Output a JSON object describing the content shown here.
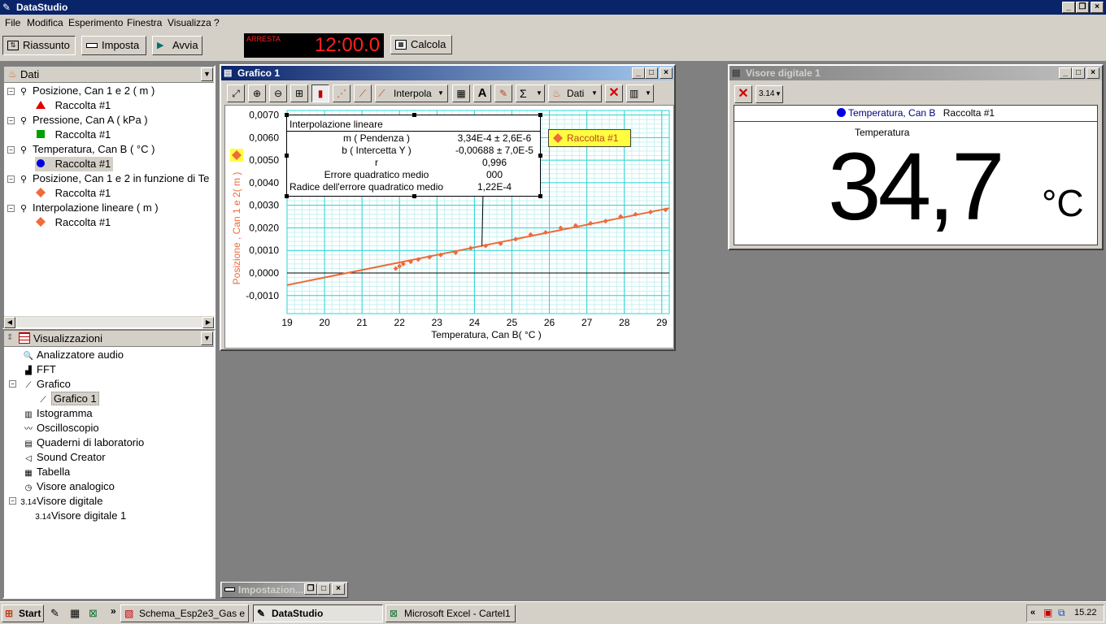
{
  "app": {
    "title": "DataStudio"
  },
  "menu": [
    "File",
    "Modifica",
    "Esperimento",
    "Finestra",
    "Visualizza",
    "?"
  ],
  "toolbar": {
    "summary": "Riassunto",
    "setup": "Imposta",
    "start": "Avvia",
    "timer_status": "ARRESTA",
    "timer": "12:00.0",
    "calc": "Calcola"
  },
  "data_panel": {
    "header": "Dati",
    "items": [
      {
        "label": "Posizione, Can 1 e 2 ( m )",
        "sub": "Raccolta #1",
        "color": "#e00000",
        "marker": "triangle"
      },
      {
        "label": "Pressione, Can A ( kPa )",
        "sub": "Raccolta #1",
        "color": "#00a000",
        "marker": "square"
      },
      {
        "label": "Temperatura, Can B ( °C )",
        "sub": "Raccolta #1",
        "color": "#0000e0",
        "marker": "circle"
      },
      {
        "label": "Posizione, Can 1 e 2 in funzione di Te",
        "sub": "Raccolta #1",
        "color": "#f06a3a",
        "marker": "diamond"
      },
      {
        "label": "Interpolazione lineare ( m )",
        "sub": "Raccolta #1",
        "color": "#f06a3a",
        "marker": "diamond"
      }
    ]
  },
  "views_panel": {
    "header": "Visualizzazioni",
    "items": [
      {
        "label": "Analizzatore audio",
        "level": 1
      },
      {
        "label": "FFT",
        "level": 1
      },
      {
        "label": "Grafico",
        "level": 1
      },
      {
        "label": "Grafico 1",
        "level": 2
      },
      {
        "label": "Istogramma",
        "level": 1
      },
      {
        "label": "Oscilloscopio",
        "level": 1
      },
      {
        "label": "Quaderni di laboratorio",
        "level": 1
      },
      {
        "label": "Sound Creator",
        "level": 1
      },
      {
        "label": "Tabella",
        "level": 1
      },
      {
        "label": "Visore analogico",
        "level": 1
      },
      {
        "label": "Visore digitale",
        "level": 1
      },
      {
        "label": "Visore digitale 1",
        "level": 2
      }
    ]
  },
  "graph_window": {
    "title": "Grafico 1",
    "toolbar": {
      "fit": "Interpola",
      "data": "Dati"
    },
    "legend": "Raccolta #1",
    "stats_box": {
      "title": "Interpolazione lineare",
      "rows": [
        {
          "label": "m ( Pendenza )",
          "value": "3,34E-4 ± 2,6E-6"
        },
        {
          "label": "b ( Intercetta Y )",
          "value": "-0,00688 ± 7,0E-5"
        },
        {
          "label": "r",
          "value": "0,996"
        },
        {
          "label": "Errore quadratico medio",
          "value": "000"
        },
        {
          "label": "Radice dell'errore quadratico medio",
          "value": "1,22E-4"
        }
      ]
    }
  },
  "chart_data": {
    "type": "scatter",
    "xlabel": "Temperatura, Can B( °C )",
    "ylabel": "Posizione , Can 1 e 2( m )",
    "xlim": [
      19,
      29.2
    ],
    "ylim": [
      -0.0018,
      0.0072
    ],
    "x_ticks": [
      19,
      20,
      21,
      22,
      23,
      24,
      25,
      26,
      27,
      28,
      29
    ],
    "y_ticks": [
      -0.001,
      0,
      0.001,
      0.002,
      0.003,
      0.004,
      0.005,
      0.006,
      0.007
    ],
    "x_tick_labels": [
      "19",
      "20",
      "21",
      "22",
      "23",
      "24",
      "25",
      "26",
      "27",
      "28",
      "29"
    ],
    "y_tick_labels": [
      "-0,0010",
      "0,0000",
      "0,0010",
      "0,0020",
      "0,0030",
      "0,0040",
      "0,0050",
      "0,0060",
      "0,0070"
    ],
    "grid": true,
    "series": [
      {
        "name": "Raccolta #1",
        "color": "#f06a3a",
        "x": [
          21.9,
          22.0,
          22.1,
          22.3,
          22.5,
          22.8,
          23.1,
          23.5,
          23.9,
          24.3,
          24.7,
          25.1,
          25.5,
          25.9,
          26.3,
          26.7,
          27.1,
          27.5,
          27.9,
          28.3,
          28.7,
          29.1
        ],
        "y": [
          0.0002,
          0.0003,
          0.0004,
          0.0005,
          0.0006,
          0.0007,
          0.0008,
          0.0009,
          0.0011,
          0.0012,
          0.0013,
          0.0015,
          0.0017,
          0.0018,
          0.002,
          0.0021,
          0.0022,
          0.0023,
          0.0025,
          0.0026,
          0.0027,
          0.0028
        ]
      },
      {
        "name": "Interpolazione lineare",
        "color": "#f06a3a",
        "fit": {
          "slope": 0.000334,
          "intercept": -0.00688
        },
        "x_range": [
          19,
          29.2
        ]
      }
    ]
  },
  "digital_window": {
    "title": "Visore digitale 1",
    "source": "Temperatura, Can B",
    "run": "Raccolta #1",
    "label": "Temperatura",
    "value": "34,7",
    "unit": "°C"
  },
  "settings_window": {
    "title": "Impostazion..."
  },
  "taskbar": {
    "start": "Start",
    "tasks": [
      "Schema_Esp2e3_Gas e ...",
      "DataStudio",
      "Microsoft Excel - Cartel1"
    ],
    "clock": "15.22"
  }
}
